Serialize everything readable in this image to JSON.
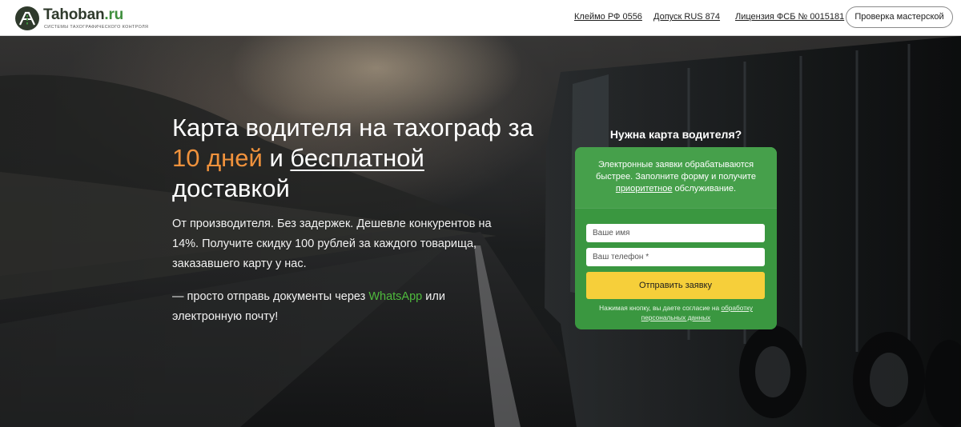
{
  "header": {
    "logo": {
      "name_main": "Tahoban",
      "name_suffix": ".ru",
      "tagline": "системы тахографического контроля"
    },
    "nav": [
      {
        "label": "Клеймо РФ 0556"
      },
      {
        "label": "Допуск RUS 874"
      },
      {
        "label": "Лицензия ФСБ № 0015181"
      }
    ],
    "cta_label": "Проверка мастерской"
  },
  "hero": {
    "headline": {
      "part1": "Карта водителя на тахограф за ",
      "accent": "10 дней",
      "part2": " и ",
      "underlined": "бесплатной",
      "part3": " доставкой"
    },
    "lead": "От производителя. Без задержек. Дешевле конкурентов на 14%. Получите скидку 100 рублей за каждого товарища, заказавшего карту у нас.",
    "whatsapp": {
      "before": "— просто отправь документы через ",
      "link": "WhatsApp",
      "after": " или электронную почту!"
    }
  },
  "form": {
    "title": "Нужна карта водителя?",
    "intro_before": "Электронные заявки обрабатываются быстрее. Заполните форму и получите ",
    "intro_link": "приоритетное",
    "intro_after": " обслуживание.",
    "name_placeholder": "Ваше имя",
    "phone_placeholder": "Ваш телефон *",
    "submit_label": "Отправить заявку",
    "consent_before": "Нажимая кнопку, вы даете согласие на ",
    "consent_link": "обработку персональных данных"
  },
  "colors": {
    "accent_orange": "#f0923c",
    "form_green": "#3a9740",
    "button_yellow": "#f6cf3a",
    "whatsapp_green": "#4fbb3d"
  }
}
